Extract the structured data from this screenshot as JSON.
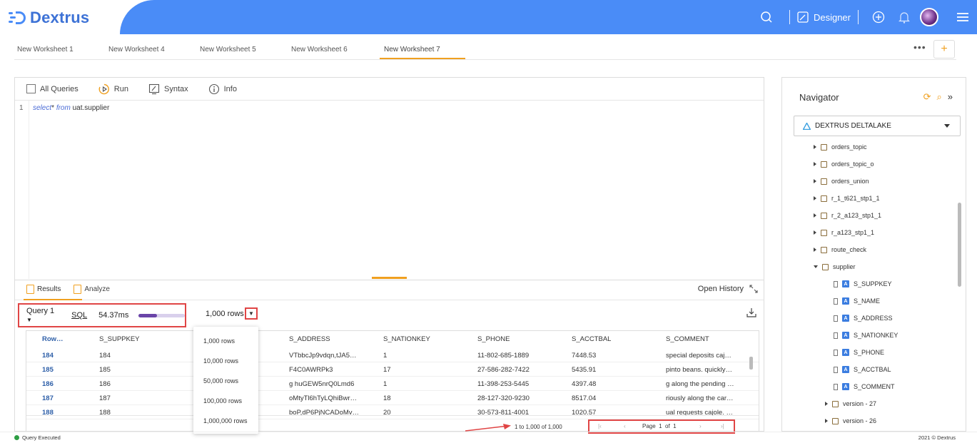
{
  "app": {
    "name": "Dextrus",
    "accent": "#4a8cf7",
    "highlight": "#f0a020"
  },
  "header": {
    "designer_label": "Designer",
    "icons": [
      "search-icon",
      "designer-icon",
      "add-circle-icon",
      "bell-icon",
      "avatar",
      "menu-icon"
    ]
  },
  "worksheets": [
    "New Worksheet 1",
    "New Worksheet 4",
    "New Worksheet 5",
    "New Worksheet 6",
    "New Worksheet 7"
  ],
  "active_worksheet": "New Worksheet 7",
  "toolbar": {
    "all_queries": "All Queries",
    "run": "Run",
    "syntax": "Syntax",
    "info": "Info"
  },
  "editor": {
    "line_number": "1",
    "kw_select": "select",
    "star": "*",
    "kw_from": "from",
    "table": "uat.supplier"
  },
  "results": {
    "tab_results": "Results",
    "tab_analyze": "Analyze",
    "open_history": "Open History",
    "query_label": "Query 1",
    "sql_link": "SQL",
    "elapsed": "54.37ms",
    "progress_fraction": 0.4,
    "rows_selected": "1,000 rows",
    "columns": [
      "Row…",
      "S_SUPPKEY",
      "S_ADDRESS",
      "S_NATIONKEY",
      "S_PHONE",
      "S_ACCTBAL",
      "S_COMMENT"
    ],
    "rows": [
      {
        "row": "184",
        "suppkey": "184",
        "address": "VTbbcJp9vdqn,tJA5…",
        "nationkey": "1",
        "phone": "11-802-685-1889",
        "acctbal": "7448.53",
        "comment": "special deposits caj…"
      },
      {
        "row": "185",
        "suppkey": "185",
        "address": "F4C0AWRPk3",
        "nationkey": "17",
        "phone": "27-586-282-7422",
        "acctbal": "5435.91",
        "comment": "pinto beans. quickly…"
      },
      {
        "row": "186",
        "suppkey": "186",
        "address": "g huGEW5nrQ0Lmd6",
        "nationkey": "1",
        "phone": "11-398-253-5445",
        "acctbal": "4397.48",
        "comment": "g along the pending …"
      },
      {
        "row": "187",
        "suppkey": "187",
        "address": "oMtyTl6hTyLQhiBwr…",
        "nationkey": "18",
        "phone": "28-127-320-9230",
        "acctbal": "8517.04",
        "comment": "riously along the car…"
      },
      {
        "row": "188",
        "suppkey": "188",
        "address": "boP,dP6PjNCADoMv…",
        "nationkey": "20",
        "phone": "30-573-811-4001",
        "acctbal": "1020.57",
        "comment": "ual requests cajole. …"
      }
    ],
    "row_options": [
      "1,000 rows",
      "10,000 rows",
      "50,000 rows",
      "100,000 rows",
      "1,000,000 rows"
    ],
    "pagination_info": "1 to 1,000 of 1,000",
    "page_label": "Page",
    "page_current": "1",
    "page_of": "of",
    "page_total": "1"
  },
  "navigator": {
    "title": "Navigator",
    "source": "DEXTRUS DELTALAKE",
    "tables": [
      "orders_topic",
      "orders_topic_o",
      "orders_union",
      "r_1_t621_stp1_1",
      "r_2_a123_stp1_1",
      "r_a123_stp1_1",
      "route_check",
      "supplier"
    ],
    "columns": [
      "S_SUPPKEY",
      "S_NAME",
      "S_ADDRESS",
      "S_NATIONKEY",
      "S_PHONE",
      "S_ACCTBAL",
      "S_COMMENT"
    ],
    "versions": [
      "version - 27",
      "version - 26"
    ]
  },
  "status": {
    "left": "Query Executed",
    "right": "2021 © Dextrus"
  }
}
